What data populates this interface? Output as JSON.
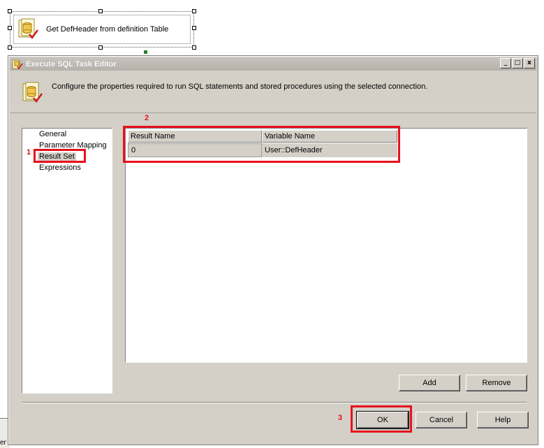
{
  "designer": {
    "task_label": "Get DefHeader from definition Table",
    "bottom_fragment": "er"
  },
  "dialog": {
    "title": "Execute SQL Task Editor",
    "window_buttons": [
      "_",
      "□",
      "x"
    ],
    "description": "Configure the properties required to run SQL statements and stored procedures using the selected connection.",
    "icon": "sql-task-icon"
  },
  "nav": {
    "items": [
      "General",
      "Parameter Mapping",
      "Result Set",
      "Expressions"
    ],
    "selected": "Result Set"
  },
  "result_set": {
    "columns": [
      "Result Name",
      "Variable Name"
    ],
    "rows": [
      [
        "0",
        "User::DefHeader"
      ]
    ]
  },
  "buttons": {
    "add": "Add",
    "remove": "Remove",
    "ok": "OK",
    "cancel": "Cancel",
    "help": "Help"
  },
  "annotations": {
    "label1": "1",
    "label2": "2",
    "label3": "3",
    "color": "#e8111c"
  }
}
